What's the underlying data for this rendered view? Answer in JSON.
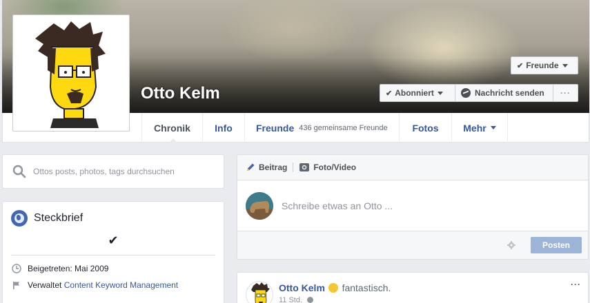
{
  "profile": {
    "name": "Otto Kelm"
  },
  "header_buttons": {
    "friends": "Freunde",
    "subscribed": "Abonniert",
    "message": "Nachricht senden",
    "more": "···"
  },
  "nav": {
    "tabs": [
      {
        "label": "Chronik"
      },
      {
        "label": "Info"
      },
      {
        "label": "Freunde",
        "sub": "436 gemeinsame Freunde"
      },
      {
        "label": "Fotos"
      },
      {
        "label": "Mehr"
      }
    ]
  },
  "search": {
    "placeholder": "Ottos posts, photos, tags durchsuchen"
  },
  "intro": {
    "title": "Steckbrief",
    "check": "✔",
    "joined": "Beigetreten: Mai 2009",
    "manages_prefix": "Verwaltet",
    "manages_link": "Content Keyword Management"
  },
  "composer": {
    "tab_post": "Beitrag",
    "tab_photo": "Foto/Video",
    "placeholder": "Schreibe etwas an Otto ...",
    "post_button": "Posten"
  },
  "feed_post": {
    "author": "Otto Kelm",
    "feeling": "fantastisch.",
    "time": "11 Std."
  },
  "colors": {
    "link": "#365899",
    "brand": "#4267b2",
    "post_button": "#9cb4d8"
  }
}
